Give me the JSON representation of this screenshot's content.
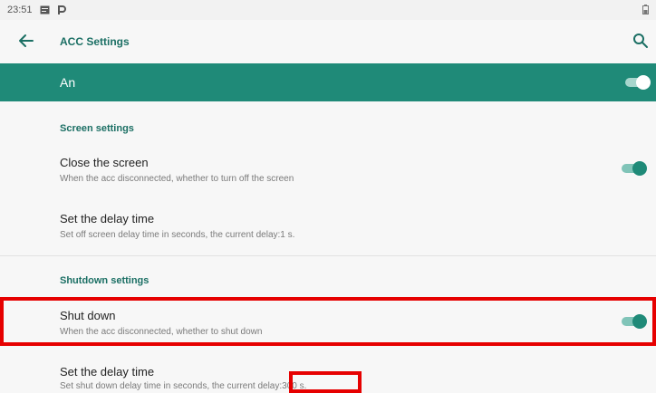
{
  "status_bar": {
    "time": "23:51"
  },
  "toolbar": {
    "title": "ACC Settings"
  },
  "master_switch": {
    "label": "An",
    "checked": true
  },
  "sections": [
    {
      "header": "Screen settings",
      "items": [
        {
          "title": "Close the screen",
          "summary": "When the acc disconnected, whether to turn off the screen",
          "toggle": true
        },
        {
          "title": "Set the delay time",
          "summary": "Set off screen delay time in seconds, the current delay:1 s."
        }
      ]
    },
    {
      "header": "Shutdown settings",
      "items": [
        {
          "title": "Shut down",
          "summary": "When the acc disconnected, whether to shut down",
          "toggle": true
        },
        {
          "title": "Set the delay time",
          "summary": "Set shut down delay time in seconds, the current delay:300 s."
        }
      ]
    }
  ],
  "colors": {
    "accent": "#1f8a78",
    "accent_text": "#1b6f64",
    "annotation": "#e60000"
  },
  "icons": {
    "back": "arrow-left-icon",
    "search": "search-icon"
  }
}
